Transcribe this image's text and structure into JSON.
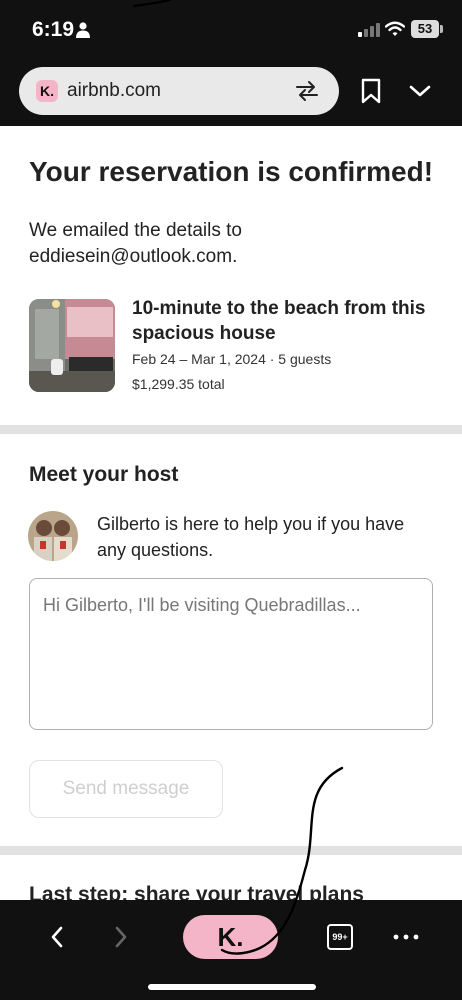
{
  "status_bar": {
    "time": "6:19",
    "battery": "53"
  },
  "browser": {
    "url": "airbnb.com",
    "favicon_letter": "K."
  },
  "reservation": {
    "title": "Your reservation is confirmed!",
    "email_note": "We emailed the details to eddiesein@outlook.com.",
    "listing_title": "10-minute to the beach from this spacious house",
    "dates_guests": "Feb 24 – Mar 1, 2024 · 5 guests",
    "total": "$1,299.35 total"
  },
  "host": {
    "heading": "Meet your host",
    "note": "Gilberto is here to help you if you have any questions.",
    "message_placeholder": "Hi Gilberto, I'll be visiting Quebradillas...",
    "send_label": "Send message"
  },
  "next_step": "Last step: share your travel plans",
  "bottom_bar": {
    "klarna_label": "K.",
    "tabs_count": "99+"
  },
  "icons": [
    "person-icon",
    "signal-icon",
    "wifi-icon",
    "translate-icon",
    "bookmark-icon",
    "chevron-down-icon",
    "back-icon",
    "forward-icon",
    "more-icon"
  ],
  "colors": {
    "klarna_pink": "#f5b5c8",
    "chrome_dark": "#111111",
    "divider": "#e2e2e2"
  }
}
